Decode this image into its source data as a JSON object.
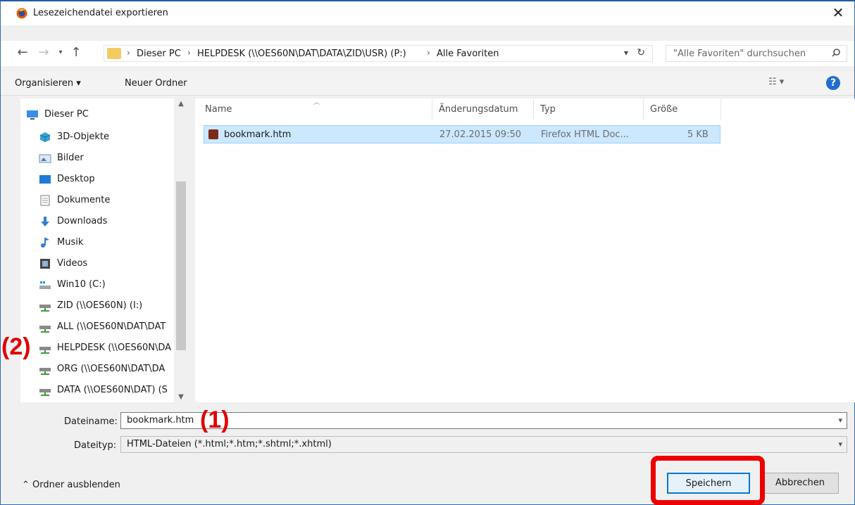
{
  "window": {
    "title": "Lesezeichendatei exportieren",
    "close": "✕"
  },
  "address": {
    "breadcrumbs": [
      "Dieser PC",
      "HELPDESK (\\\\OES60N\\DAT\\DATA\\ZID\\USR) (P:)",
      "Alle Favoriten"
    ],
    "search_placeholder": "\"Alle Favoriten\" durchsuchen"
  },
  "toolbar": {
    "organize": "Organisieren ▾",
    "new_folder": "Neuer Ordner"
  },
  "nav": {
    "items": [
      {
        "label": "Dieser PC",
        "icon": "pc-icon"
      },
      {
        "label": "3D-Objekte",
        "icon": "cube-icon"
      },
      {
        "label": "Bilder",
        "icon": "pictures-icon"
      },
      {
        "label": "Desktop",
        "icon": "desktop-icon"
      },
      {
        "label": "Dokumente",
        "icon": "document-icon"
      },
      {
        "label": "Downloads",
        "icon": "download-icon"
      },
      {
        "label": "Musik",
        "icon": "music-icon"
      },
      {
        "label": "Videos",
        "icon": "video-icon"
      },
      {
        "label": "Win10 (C:)",
        "icon": "drive-icon"
      },
      {
        "label": "ZID (\\\\OES60N) (I:)",
        "icon": "network-drive-icon"
      },
      {
        "label": "ALL (\\\\OES60N\\DAT\\DAT",
        "icon": "network-drive-icon"
      },
      {
        "label": "HELPDESK (\\\\OES60N\\DA",
        "icon": "network-drive-icon"
      },
      {
        "label": "ORG (\\\\OES60N\\DAT\\DA",
        "icon": "network-drive-icon"
      },
      {
        "label": "DATA (\\\\OES60N\\DAT) (S",
        "icon": "network-drive-icon"
      }
    ]
  },
  "files": {
    "columns": [
      "Name",
      "Änderungsdatum",
      "Typ",
      "Größe"
    ],
    "rows": [
      {
        "name": "bookmark.htm",
        "date": "27.02.2015 09:50",
        "type": "Firefox HTML Doc...",
        "size": "5 KB"
      }
    ]
  },
  "form": {
    "filename_label": "Dateiname:",
    "filename_value": "bookmark.htm",
    "filetype_label": "Dateityp:",
    "filetype_value": "HTML-Dateien (*.html;*.htm;*.shtml;*.xhtml)"
  },
  "footer": {
    "hide_folders": "Ordner ausblenden",
    "save": "Speichern",
    "cancel": "Abbrechen"
  },
  "annotations": {
    "marker1": "(1)",
    "marker2": "(2)"
  },
  "colors": {
    "accent": "#0078d7",
    "annotation": "#ee0000",
    "selection": "#cce8ff"
  }
}
